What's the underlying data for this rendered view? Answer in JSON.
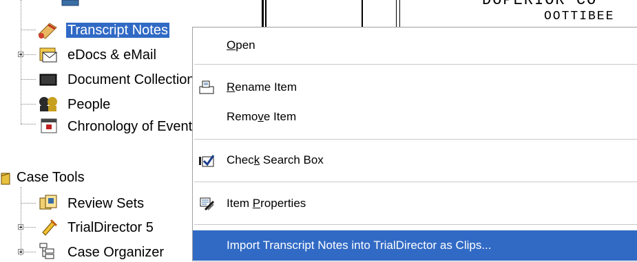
{
  "tree": {
    "items": [
      {
        "label": "Transcript Notes",
        "selected": true
      },
      {
        "label": "eDocs & eMail"
      },
      {
        "label": "Document Collections"
      },
      {
        "label": "People"
      },
      {
        "label": "Chronology of Events"
      }
    ],
    "case_tools": {
      "label": "Case Tools",
      "items": [
        {
          "label": "Review Sets"
        },
        {
          "label": "TrialDirector 5"
        },
        {
          "label": "Case Organizer"
        }
      ]
    }
  },
  "menu": {
    "open": {
      "pre": "",
      "accel": "O",
      "post": "pen"
    },
    "rename": {
      "pre": "",
      "accel": "R",
      "post": "ename Item"
    },
    "remove": {
      "pre": "Remo",
      "accel": "v",
      "post": "e Item"
    },
    "check_search": {
      "pre": "Chec",
      "accel": "k",
      "post": " Search Box"
    },
    "properties": {
      "pre": "Item ",
      "accel": "P",
      "post": "roperties"
    },
    "import": {
      "label": "Import Transcript Notes into TrialDirector as Clips..."
    }
  },
  "colors": {
    "selection": "#316ac5",
    "menu_background": "#ffffff"
  }
}
